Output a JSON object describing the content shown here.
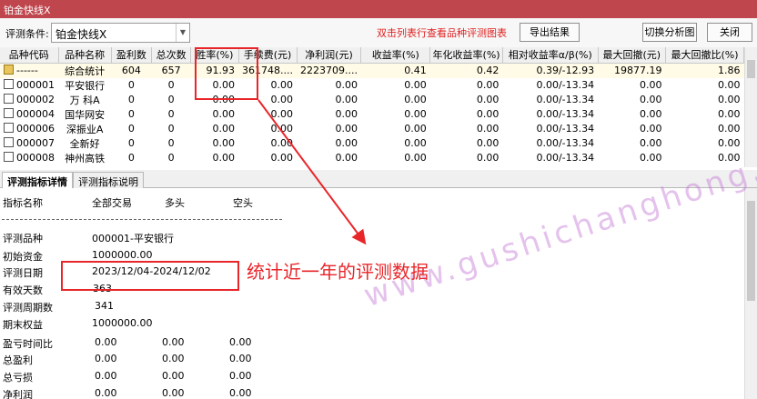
{
  "window": {
    "title": "铂金快线X"
  },
  "toolbar": {
    "condition_label": "评测条件:",
    "condition_value": "铂金快线X",
    "hint": "双击列表行查看品种评测图表",
    "export_label": "导出结果",
    "switch_label": "切换分析图",
    "close_label": "关闭"
  },
  "table": {
    "columns": [
      "品种代码",
      "品种名称",
      "盈利数",
      "总次数",
      "胜率(%)",
      "手续费(元)",
      "净利润(元)",
      "收益率(%)",
      "年化收益率(%)",
      "相对收益率α/β(%)",
      "最大回撤(元)",
      "最大回撤比(%)"
    ],
    "rows": [
      {
        "icon": "summary-icon",
        "cells": [
          "------",
          "综合统计",
          "604",
          "657",
          "91.93",
          "361748....",
          "2223709....",
          "0.41",
          "0.42",
          "0.39/-12.93",
          "19877.19",
          "1.86"
        ]
      },
      {
        "icon": "stock-icon",
        "cells": [
          "000001",
          "平安银行",
          "0",
          "0",
          "0.00",
          "0.00",
          "0.00",
          "0.00",
          "0.00",
          "0.00/-13.34",
          "0.00",
          "0.00"
        ]
      },
      {
        "icon": "stock-icon",
        "cells": [
          "000002",
          "万 科A",
          "0",
          "0",
          "0.00",
          "0.00",
          "0.00",
          "0.00",
          "0.00",
          "0.00/-13.34",
          "0.00",
          "0.00"
        ]
      },
      {
        "icon": "stock-icon",
        "cells": [
          "000004",
          "国华网安",
          "0",
          "0",
          "0.00",
          "0.00",
          "0.00",
          "0.00",
          "0.00",
          "0.00/-13.34",
          "0.00",
          "0.00"
        ]
      },
      {
        "icon": "stock-icon",
        "cells": [
          "000006",
          "深振业A",
          "0",
          "0",
          "0.00",
          "0.00",
          "0.00",
          "0.00",
          "0.00",
          "0.00/-13.34",
          "0.00",
          "0.00"
        ]
      },
      {
        "icon": "stock-icon",
        "cells": [
          "000007",
          "全新好",
          "0",
          "0",
          "0.00",
          "0.00",
          "0.00",
          "0.00",
          "0.00",
          "0.00/-13.34",
          "0.00",
          "0.00"
        ]
      },
      {
        "icon": "stock-icon",
        "cells": [
          "000008",
          "神州高铁",
          "0",
          "0",
          "0.00",
          "0.00",
          "0.00",
          "0.00",
          "0.00",
          "0.00/-13.34",
          "0.00",
          "0.00"
        ]
      }
    ]
  },
  "tabs": [
    {
      "label": "评测指标详情"
    },
    {
      "label": "评测指标说明"
    }
  ],
  "detail": {
    "header": {
      "name": "指标名称",
      "all": "全部交易",
      "long": "多头",
      "short": "空头"
    },
    "rows": [
      {
        "label": "评测品种",
        "v1": "000001-平安银行",
        "v2": "",
        "v3": ""
      },
      {
        "label": "初始资金",
        "v1": "1000000.00",
        "v2": "",
        "v3": ""
      },
      {
        "label": "评测日期",
        "v1": "2023/12/04-2024/12/02",
        "v2": "",
        "v3": ""
      },
      {
        "label": "有效天数",
        "v1": "363",
        "v2": "",
        "v3": ""
      },
      {
        "label": "评测周期数",
        "v1": "341",
        "v2": "",
        "v3": ""
      },
      {
        "label": "期末权益",
        "v1": "1000000.00",
        "v2": "",
        "v3": ""
      },
      {
        "label": "盈亏时间比",
        "v1": "0.00",
        "v2": "0.00",
        "v3": "0.00"
      },
      {
        "label": "总盈利",
        "v1": "0.00",
        "v2": "0.00",
        "v3": "0.00"
      },
      {
        "label": "总亏损",
        "v1": "0.00",
        "v2": "0.00",
        "v3": "0.00"
      },
      {
        "label": "净利润",
        "v1": "0.00",
        "v2": "0.00",
        "v3": "0.00"
      }
    ]
  },
  "annotation": {
    "text": "统计近一年的评测数据",
    "color": "#e8262a"
  },
  "watermark": {
    "text": "www.gushichanghong.com"
  },
  "colors": {
    "titlebar": "#c0464d",
    "accent_red": "#e8262a",
    "hint_red": "#e02020"
  }
}
